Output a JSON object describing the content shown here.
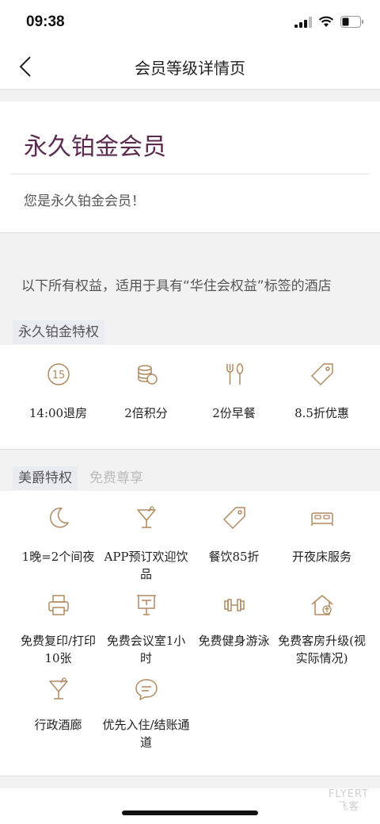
{
  "status_bar": {
    "time": "09:38"
  },
  "nav": {
    "title": "会员等级详情页"
  },
  "level": {
    "title": "永久铂金会员",
    "description": "您是永久铂金会员！"
  },
  "scope_note": "以下所有权益，适用于具有“华住会权益”标签的酒店",
  "platinum": {
    "tag": "永久铂金特权",
    "items": [
      {
        "icon": "clock-15-icon",
        "label": "14:00退房"
      },
      {
        "icon": "coin-stack-icon",
        "label": "2倍积分"
      },
      {
        "icon": "fork-knife-icon",
        "label": "2份早餐"
      },
      {
        "icon": "price-tag-icon",
        "label": "8.5折优惠"
      }
    ]
  },
  "jazz": {
    "tabs": [
      "美爵特权",
      "免费尊享"
    ],
    "items": [
      {
        "icon": "moon-icon",
        "label": "1晚=2个间夜"
      },
      {
        "icon": "cocktail-icon",
        "label": "APP预订欢迎饮品"
      },
      {
        "icon": "price-tag-icon",
        "label": "餐饮85折"
      },
      {
        "icon": "bed-icon",
        "label": "开夜床服务"
      },
      {
        "icon": "printer-icon",
        "label": "免费复印/打印10张"
      },
      {
        "icon": "meeting-board-icon",
        "label": "免费会议室1小时"
      },
      {
        "icon": "dumbbell-icon",
        "label": "免费健身游泳"
      },
      {
        "icon": "house-upgrade-icon",
        "label": "免费客房升级(视实际情况)"
      },
      {
        "icon": "cocktail-icon",
        "label": "行政酒廊"
      },
      {
        "icon": "chat-bubble-icon",
        "label": "优先入住/结账通道"
      }
    ]
  },
  "watermark": {
    "line1": "FLYERT",
    "line2": "飞客"
  },
  "colors": {
    "accent_gold": "#b08a60",
    "level_purple": "#5a2a4f",
    "tag_bg": "#ebebf2"
  }
}
